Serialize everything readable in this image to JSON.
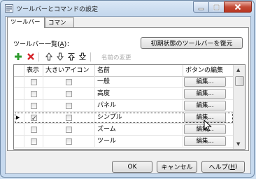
{
  "window": {
    "title": "ツールバーとコマンドの設定"
  },
  "tabs": [
    {
      "label": "ツールバー",
      "active": true
    },
    {
      "label": "コマンド",
      "active": false
    }
  ],
  "list_label": {
    "text": "ツールバー一覧(",
    "mnemonic": "A",
    "suffix": ")："
  },
  "reset_button": "初期状態のツールバーを復元",
  "toolbar": {
    "rename_label": "名前の変更"
  },
  "grid": {
    "headers": {
      "show": "表示",
      "large_icons": "大きいアイコン",
      "name": "名前",
      "buttons": "ボタンの編集"
    },
    "rows": [
      {
        "show": false,
        "large": false,
        "name": "一般",
        "edit": "編集..."
      },
      {
        "show": false,
        "large": false,
        "name": "高度",
        "edit": "編集..."
      },
      {
        "show": false,
        "large": false,
        "name": "パネル",
        "edit": "編集..."
      },
      {
        "show": true,
        "large": false,
        "name": "シンプル",
        "edit": "編集...",
        "selected": true
      },
      {
        "show": false,
        "large": false,
        "name": "ズーム",
        "edit": "編集..."
      },
      {
        "show": false,
        "large": false,
        "name": "ツール",
        "edit": "編集..."
      }
    ]
  },
  "footer": {
    "ok": "OK",
    "cancel": "キャンセル",
    "help": "ヘルプ(",
    "help_mnemonic": "H",
    "help_suffix": ")"
  }
}
